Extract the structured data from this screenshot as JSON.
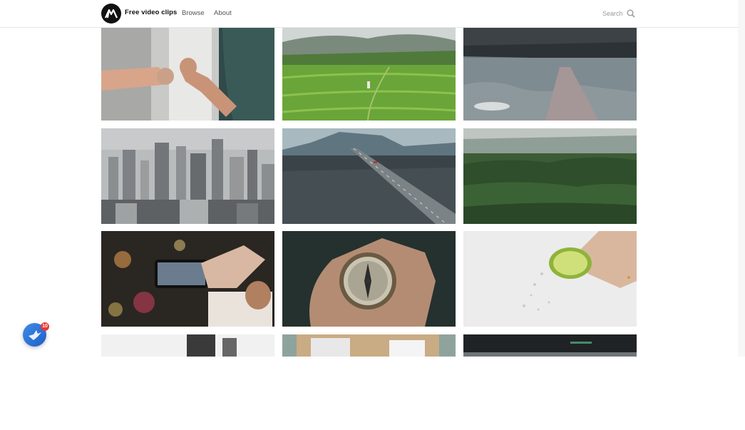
{
  "header": {
    "brand": "Free video clips",
    "nav": [
      {
        "label": "Browse"
      },
      {
        "label": "About"
      }
    ],
    "search_label": "Search"
  },
  "clips": [
    {
      "subject": "fist bump"
    },
    {
      "subject": "rice field runner"
    },
    {
      "subject": "lake pier"
    },
    {
      "subject": "city skyline"
    },
    {
      "subject": "road through mountains"
    },
    {
      "subject": "pine forest"
    },
    {
      "subject": "phone photo night street"
    },
    {
      "subject": "compass in hand"
    },
    {
      "subject": "lime squeeze"
    },
    {
      "subject": "microscope"
    },
    {
      "subject": "desk documents"
    },
    {
      "subject": "dark screen"
    }
  ],
  "chat_widget": {
    "badge_count": "10"
  },
  "colors": {
    "brand_dark": "#111111",
    "chat_blue": "#2f76dc",
    "badge_red": "#e53935"
  }
}
